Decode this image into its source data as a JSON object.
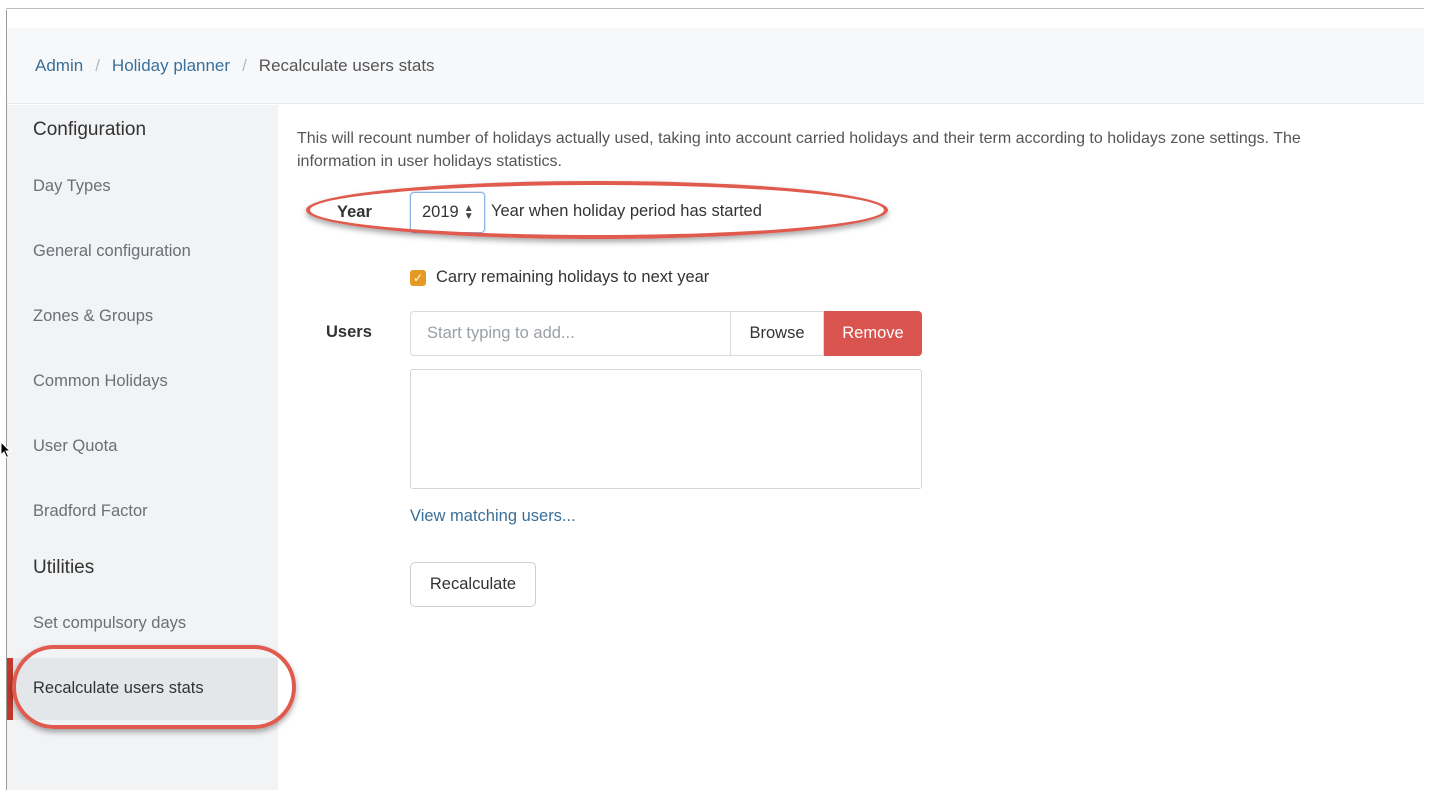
{
  "breadcrumb": {
    "items": [
      "Admin",
      "Holiday planner"
    ],
    "separator": "/",
    "current": "Recalculate users stats"
  },
  "sidebar": {
    "sections": [
      {
        "heading": "Configuration",
        "items": [
          "Day Types",
          "General configuration",
          "Zones & Groups",
          "Common Holidays",
          "User Quota",
          "Bradford Factor"
        ]
      },
      {
        "heading": "Utilities",
        "items": [
          "Set compulsory days",
          "Recalculate users stats"
        ]
      }
    ],
    "active_item": "Recalculate users stats"
  },
  "main": {
    "description_line1": "This will recount number of holidays actually used, taking into account carried holidays and their term according to holidays zone settings. The",
    "description_line2": "information in user holidays statistics.",
    "year": {
      "label": "Year",
      "value": "2019",
      "help": "Year when holiday period has started"
    },
    "carry": {
      "checked": true,
      "label": "Carry remaining holidays to next year"
    },
    "users": {
      "label": "Users",
      "placeholder": "Start typing to add...",
      "browse_label": "Browse",
      "remove_label": "Remove",
      "view_matching_label": "View matching users..."
    },
    "recalculate_label": "Recalculate"
  },
  "colors": {
    "accent_link": "#3a6f99",
    "remove_button": "#d9534f",
    "checkbox": "#e59a24",
    "annotation": "#e05a4e"
  }
}
